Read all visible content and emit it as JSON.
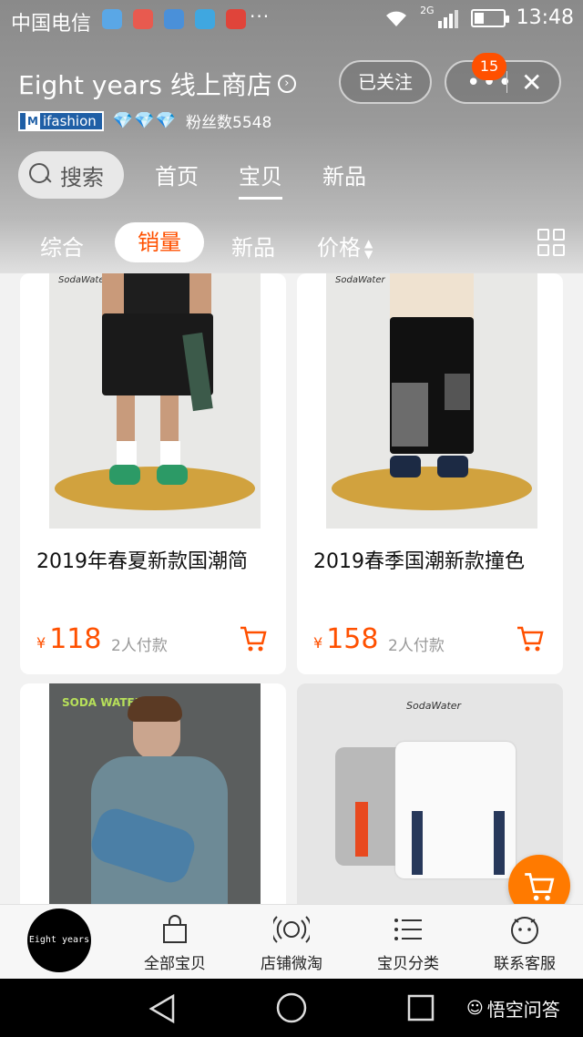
{
  "status_bar": {
    "carrier": "中国电信",
    "more": "···",
    "network": "2G",
    "time": "13:48"
  },
  "store": {
    "name": "Eight years 线上商店",
    "badge_text": "ifashion",
    "fans": "粉丝数5548"
  },
  "actions": {
    "follow": "已关注",
    "more_count": "15"
  },
  "nav_tabs": [
    {
      "label": "搜索"
    },
    {
      "label": "首页"
    },
    {
      "label": "宝贝"
    },
    {
      "label": "新品"
    }
  ],
  "sort_tabs": [
    {
      "label": "综合"
    },
    {
      "label": "销量"
    },
    {
      "label": "新品"
    },
    {
      "label": "价格"
    }
  ],
  "products": [
    {
      "title": "2019年春夏新款国潮简",
      "currency": "¥",
      "price": "118",
      "sold": "2人付款",
      "brand": "SodaWater"
    },
    {
      "title": "2019春季国潮新款撞色",
      "currency": "¥",
      "price": "158",
      "sold": "2人付款",
      "brand": "SodaWater"
    },
    {
      "brand": "SODA WATER"
    },
    {
      "brand": "SodaWater"
    }
  ],
  "bottom_nav": {
    "shop_logo": "Eight years",
    "items": [
      {
        "label": "全部宝贝"
      },
      {
        "label": "店铺微淘"
      },
      {
        "label": "宝贝分类"
      },
      {
        "label": "联系客服"
      }
    ]
  },
  "watermark": "悟空问答",
  "colors": {
    "accent": "#ff5000",
    "cart": "#ff7a00"
  }
}
